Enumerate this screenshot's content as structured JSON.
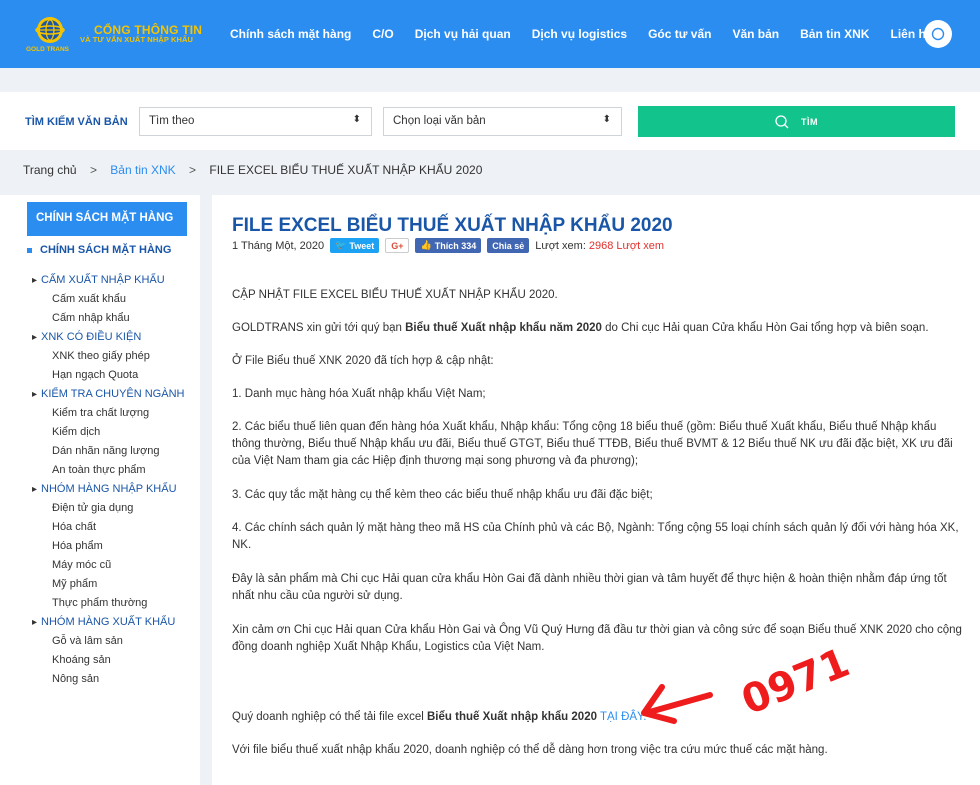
{
  "header": {
    "logo_line1": "CỔNG THÔNG TIN",
    "logo_line2": "VÀ TƯ VẤN XUẤT NHẬP KHẨU",
    "logo_badge": "GOLD TRANS",
    "nav": [
      "Chính sách mặt hàng",
      "C/O",
      "Dịch vụ hải quan",
      "Dịch vụ logistics",
      "Góc tư vấn",
      "Văn bản",
      "Bản tin XNK",
      "Liên hệ"
    ],
    "colors": {
      "primary": "#2b8df0",
      "logo_gold": "#f4c400"
    }
  },
  "searchbar": {
    "label": "TÌM KIẾM VĂN BẢN",
    "select1": "Tìm theo",
    "select2": "Chọn loại văn bản",
    "button": "TÌM",
    "button_color": "#12c38b"
  },
  "breadcrumb": {
    "home": "Trang chủ",
    "section": "Bản tin XNK",
    "current": "FILE EXCEL BIỂU THUẾ XUẤT NHẬP KHẨU 2020"
  },
  "sidebar": {
    "heading": "CHÍNH SÁCH MẶT HÀNG",
    "subheading": "CHÍNH SÁCH MẶT HÀNG",
    "items": [
      {
        "type": "cat",
        "label": "CẤM XUẤT NHẬP KHẨU"
      },
      {
        "type": "sub",
        "label": "Cấm xuất khẩu"
      },
      {
        "type": "sub",
        "label": "Cấm nhập khẩu"
      },
      {
        "type": "cat",
        "label": "XNK CÓ ĐIỀU KIỆN"
      },
      {
        "type": "sub",
        "label": "XNK theo giấy phép"
      },
      {
        "type": "sub",
        "label": "Hạn ngạch Quota"
      },
      {
        "type": "cat",
        "label": "KIỂM TRA CHUYÊN NGÀNH"
      },
      {
        "type": "sub",
        "label": "Kiểm tra chất lượng"
      },
      {
        "type": "sub",
        "label": "Kiểm dịch"
      },
      {
        "type": "sub",
        "label": "Dán nhãn năng lượng"
      },
      {
        "type": "sub",
        "label": "An toàn thực phẩm"
      },
      {
        "type": "cat",
        "label": "NHÓM HÀNG NHẬP KHẨU"
      },
      {
        "type": "sub",
        "label": "Điện tử gia dụng"
      },
      {
        "type": "sub",
        "label": "Hóa chất"
      },
      {
        "type": "sub",
        "label": "Hóa phẩm"
      },
      {
        "type": "sub",
        "label": "Máy móc cũ"
      },
      {
        "type": "sub",
        "label": "Mỹ phẩm"
      },
      {
        "type": "sub",
        "label": "Thực phẩm thường"
      },
      {
        "type": "cat",
        "label": "NHÓM HÀNG XUẤT KHẨU"
      },
      {
        "type": "sub",
        "label": "Gỗ và lâm sản"
      },
      {
        "type": "sub",
        "label": "Khoáng sản"
      },
      {
        "type": "sub",
        "label": "Nông sản"
      }
    ]
  },
  "article": {
    "title": "FILE EXCEL BIỂU THUẾ XUẤT NHẬP KHẨU 2020",
    "date": "1 Tháng Một, 2020",
    "tweet": "Tweet",
    "gplus": "G+",
    "like": "Thích 334",
    "share": "Chia sẻ",
    "views_label": "Lượt xem:",
    "views_value": "2968 Lượt xem",
    "views_color": "#e0322e",
    "p1": "CẬP NHẬT FILE EXCEL BIỂU THUẾ XUẤT NHẬP KHẨU 2020.",
    "p2_pre": "GOLDTRANS xin gửi tới quý bạn ",
    "p2_bold": "Biểu thuế Xuất nhập khẩu năm 2020",
    "p2_post": " do Chi cục Hải quan Cửa khẩu Hòn Gai tổng hợp và biên soạn.",
    "p3": "Ở File Biểu thuế XNK 2020 đã tích hợp & cập nhật:",
    "p4": "1. Danh mục hàng hóa Xuất nhập khẩu Việt Nam;",
    "p5": "2. Các biểu thuế liên quan đến hàng hóa Xuất khẩu, Nhập khẩu: Tổng cộng 18 biểu thuế (gồm: Biểu thuế Xuất khẩu, Biểu thuế Nhập khẩu thông thường, Biểu thuế Nhập khẩu ưu đãi, Biểu thuế GTGT, Biểu thuế TTĐB, Biểu thuế BVMT & 12 Biểu thuế NK ưu đãi đặc biệt, XK ưu đãi của Việt Nam tham gia các Hiệp định thương mại song phương và đa phương);",
    "p6": "3. Các quy tắc mặt hàng cụ thể kèm theo các biểu thuế nhập khẩu ưu đãi đặc biệt;",
    "p7": "4. Các chính sách quản lý mặt hàng theo mã HS của Chính phủ và các Bộ, Ngành: Tổng cộng 55 loại chính sách quản lý đối với hàng hóa XK, NK.",
    "p8": "Đây là sản phẩm mà Chi cục Hải quan cửa khẩu Hòn Gai đã dành nhiều thời gian và tâm huyết để thực hiện & hoàn thiện nhằm đáp ứng tốt nhất nhu cầu của người sử dụng.",
    "p9": "Xin cảm ơn Chi cục Hải quan Cửa khẩu Hòn Gai và Ông Vũ Quý Hưng đã đầu tư thời gian và công sức để soạn Biểu thuế XNK 2020 cho cộng đồng doanh nghiệp Xuất Nhập Khẩu, Logistics của Việt Nam.",
    "p10_pre": "Quý doanh nghiệp có thể tải file excel ",
    "p10_bold": "Biểu thuế Xuất nhập khẩu 2020",
    "p10_link": "TẠI ĐÂY.",
    "p11": "Với file biểu thuế xuất nhập khẩu 2020, doanh nghiệp có thể dễ dàng hơn trong việc tra cứu mức thuế các mặt hàng.",
    "annotation": "0971",
    "annotation_color": "#ee1c1c"
  }
}
